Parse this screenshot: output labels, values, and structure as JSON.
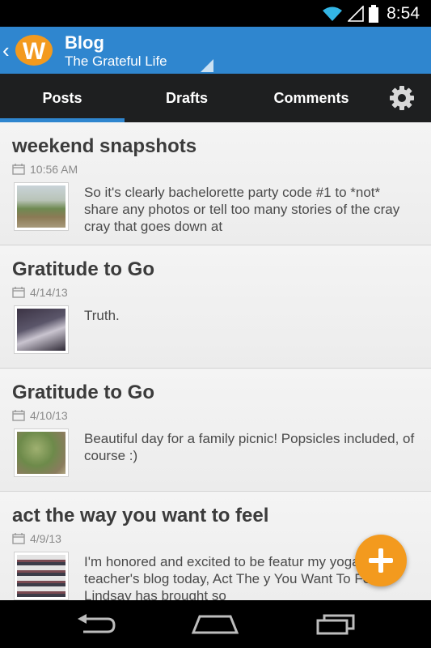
{
  "status_bar": {
    "time": "8:54",
    "icons": [
      "wifi-icon",
      "signal-icon",
      "battery-icon"
    ]
  },
  "action_bar": {
    "title": "Blog",
    "subtitle": "The Grateful Life",
    "logo_letter": "W",
    "colors": {
      "bar": "#2f86cf",
      "logo": "#f39a1e"
    }
  },
  "tabs": [
    {
      "label": "Posts",
      "selected": true
    },
    {
      "label": "Drafts",
      "selected": false
    },
    {
      "label": "Comments",
      "selected": false
    }
  ],
  "posts": [
    {
      "title": "weekend snapshots",
      "date": "10:56 AM",
      "excerpt": "So it's clearly bachelorette party code #1 to *not* share any photos or tell too many stories of the cray cray that goes down at"
    },
    {
      "title": "Gratitude to Go",
      "date": "4/14/13",
      "excerpt": "Truth."
    },
    {
      "title": "Gratitude to Go",
      "date": "4/10/13",
      "excerpt": "Beautiful day for a family picnic! Popsicles included, of course :)"
    },
    {
      "title": "act the way you want to feel",
      "date": "4/9/13",
      "excerpt": "I'm honored and excited to be featur my yoga teacher's blog today, Act The y You Want To Feel! Lindsay has brought so"
    }
  ],
  "fab": {
    "icon": "plus-icon",
    "color": "#f39a1e"
  },
  "nav_bar": {
    "buttons": [
      "back-icon",
      "home-icon",
      "recent-apps-icon"
    ]
  }
}
